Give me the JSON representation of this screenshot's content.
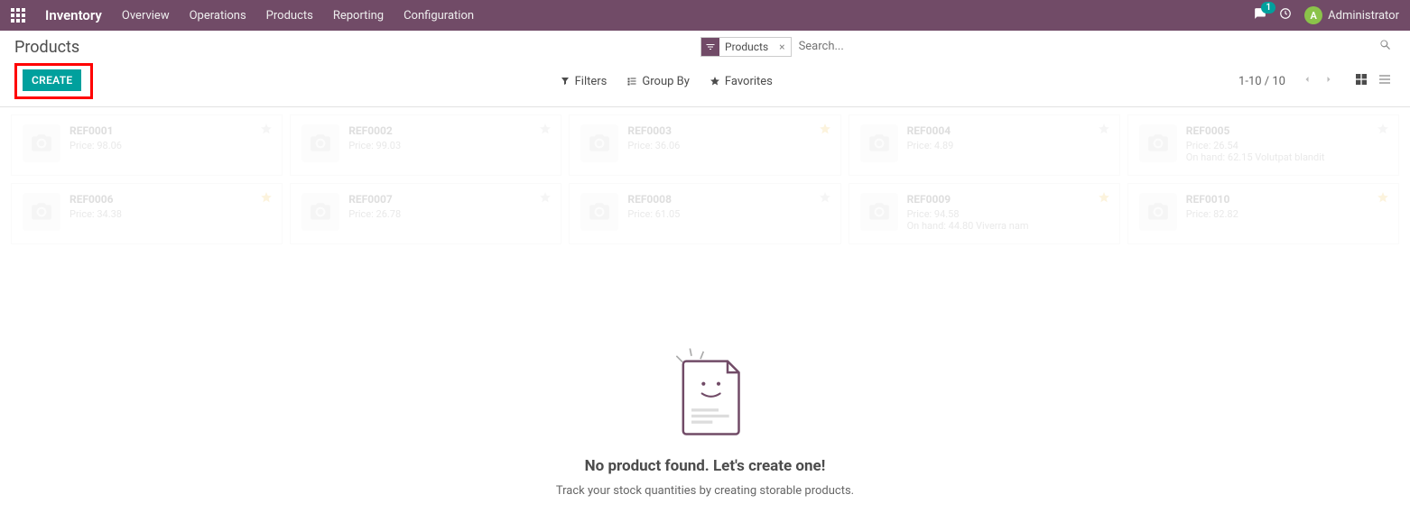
{
  "topbar": {
    "module": "Inventory",
    "nav": [
      "Overview",
      "Operations",
      "Products",
      "Reporting",
      "Configuration"
    ],
    "chat_count": "1",
    "user_initial": "A",
    "user_name": "Administrator"
  },
  "cp": {
    "breadcrumb": "Products",
    "create_label": "CREATE",
    "facet_label": "Products",
    "search_placeholder": "Search...",
    "filters_label": "Filters",
    "groupby_label": "Group By",
    "favorites_label": "Favorites",
    "pager": "1-10 / 10"
  },
  "kanban": {
    "price_prefix": "Price: ",
    "onhand_prefix": "On hand: ",
    "cards": [
      {
        "ref": "REF0001",
        "price": "98.06",
        "onhand": "",
        "star": false
      },
      {
        "ref": "REF0002",
        "price": "99.03",
        "onhand": "",
        "star": false
      },
      {
        "ref": "REF0003",
        "price": "36.06",
        "onhand": "",
        "star": true
      },
      {
        "ref": "REF0004",
        "price": "4.89",
        "onhand": "",
        "star": false
      },
      {
        "ref": "REF0005",
        "price": "26.54",
        "onhand": "62.15 Volutpat blandit",
        "star": false
      },
      {
        "ref": "REF0006",
        "price": "34.38",
        "onhand": "",
        "star": true
      },
      {
        "ref": "REF0007",
        "price": "26.78",
        "onhand": "",
        "star": false
      },
      {
        "ref": "REF0008",
        "price": "61.05",
        "onhand": "",
        "star": false
      },
      {
        "ref": "REF0009",
        "price": "94.58",
        "onhand": "44.80 Viverra nam",
        "star": true
      },
      {
        "ref": "REF0010",
        "price": "82.82",
        "onhand": "",
        "star": true
      }
    ]
  },
  "empty": {
    "title": "No product found. Let's create one!",
    "desc": "Track your stock quantities by creating storable products."
  }
}
